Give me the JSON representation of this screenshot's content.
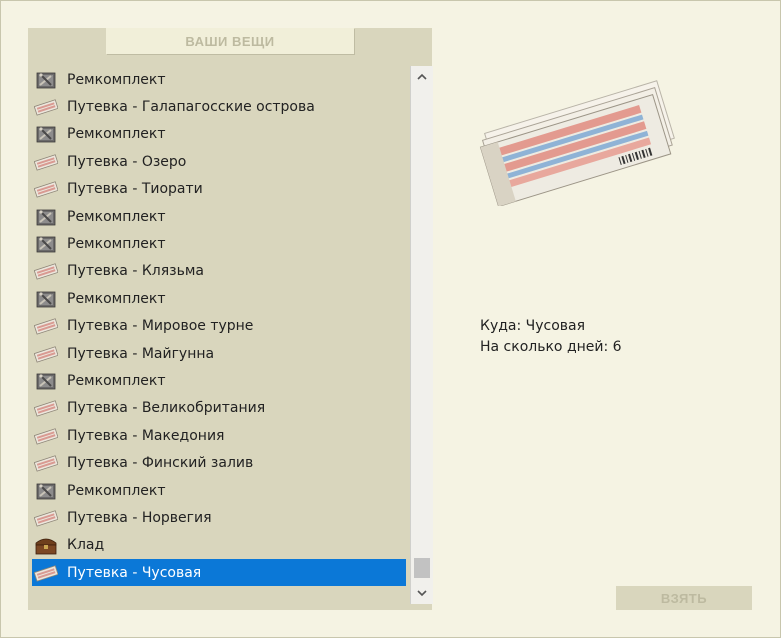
{
  "panel": {
    "title": "ВАШИ ВЕЩИ"
  },
  "items": [
    {
      "label": "Ремкомплект",
      "icon": "repair-kit-icon"
    },
    {
      "label": "Путевка - Галапагосские острова",
      "icon": "ticket-icon"
    },
    {
      "label": "Ремкомплект",
      "icon": "repair-kit-icon"
    },
    {
      "label": "Путевка - Озеро",
      "icon": "ticket-icon"
    },
    {
      "label": "Путевка - Тиорати",
      "icon": "ticket-icon"
    },
    {
      "label": "Ремкомплект",
      "icon": "repair-kit-icon"
    },
    {
      "label": "Ремкомплект",
      "icon": "repair-kit-icon"
    },
    {
      "label": "Путевка - Клязьма",
      "icon": "ticket-icon"
    },
    {
      "label": "Ремкомплект",
      "icon": "repair-kit-icon"
    },
    {
      "label": "Путевка - Мировое турне",
      "icon": "ticket-icon"
    },
    {
      "label": "Путевка - Майгунна",
      "icon": "ticket-icon"
    },
    {
      "label": "Ремкомплект",
      "icon": "repair-kit-icon"
    },
    {
      "label": "Путевка - Великобритания",
      "icon": "ticket-icon"
    },
    {
      "label": "Путевка - Македония",
      "icon": "ticket-icon"
    },
    {
      "label": "Путевка - Финский залив",
      "icon": "ticket-icon"
    },
    {
      "label": "Ремкомплект",
      "icon": "repair-kit-icon"
    },
    {
      "label": "Путевка - Норвегия",
      "icon": "ticket-icon"
    },
    {
      "label": "Клад",
      "icon": "treasure-chest-icon"
    },
    {
      "label": "Путевка - Чусовая",
      "icon": "ticket-icon",
      "selected": true
    }
  ],
  "details": {
    "destination": "Куда: Чусовая",
    "days": "На сколько дней: 6"
  },
  "take_button": {
    "label": "ВЗЯТЬ"
  },
  "colors": {
    "selection": "#0b78d7",
    "panel": "#d9d6bd",
    "background": "#f5f3e3"
  }
}
